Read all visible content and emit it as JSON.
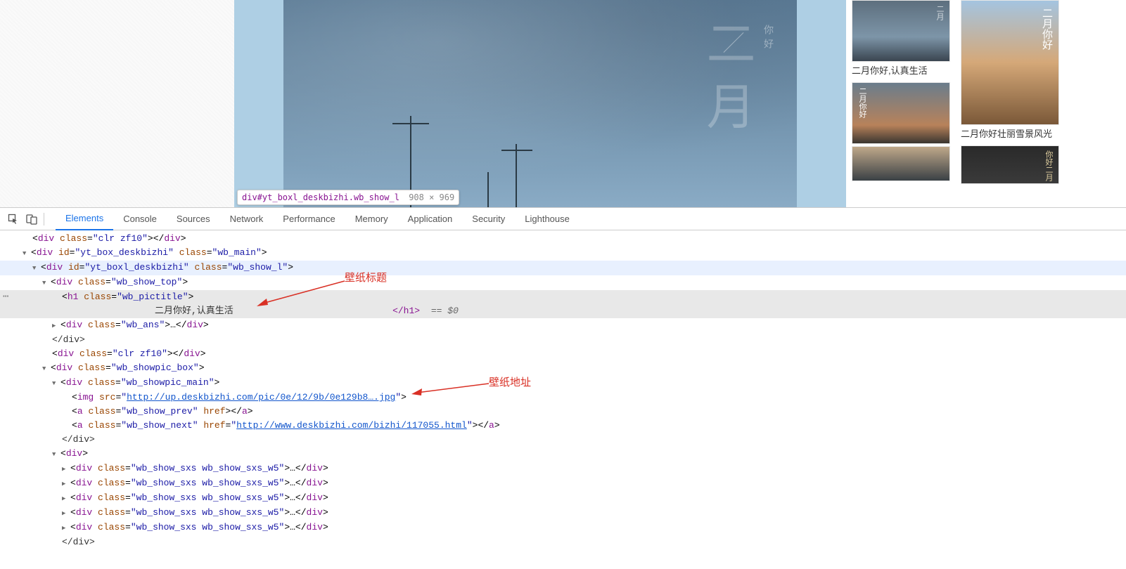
{
  "tooltip": {
    "selector": "div#yt_boxl_deskbizhi.wb_show_l",
    "dims": "908 × 969"
  },
  "main_image": {
    "small_text": "你好",
    "big_text": "二月"
  },
  "thumbs": {
    "col1": [
      {
        "cn": "二月",
        "label": "二月你好,认真生活"
      },
      {
        "cn": "二月你好",
        "label": ""
      },
      {
        "cn": "",
        "label": ""
      }
    ],
    "col2": [
      {
        "cn": "二月你好",
        "label": "二月你好壮丽雪景风光"
      },
      {
        "cn": "你好二月",
        "label": ""
      }
    ]
  },
  "devtools": {
    "tabs": [
      "Elements",
      "Console",
      "Sources",
      "Network",
      "Performance",
      "Memory",
      "Application",
      "Security",
      "Lighthouse"
    ],
    "active_tab": "Elements"
  },
  "dom": {
    "l1": {
      "tag": "div",
      "cls": "clr zf10"
    },
    "l2": {
      "tag": "div",
      "id": "yt_box_deskbizhi",
      "cls": "wb_main"
    },
    "l3": {
      "tag": "div",
      "id": "yt_boxl_deskbizhi",
      "cls": "wb_show_l"
    },
    "l4": {
      "tag": "div",
      "cls": "wb_show_top"
    },
    "l5": {
      "tag": "h1",
      "cls": "wb_pictitle"
    },
    "l5_text": "二月你好,认真生活",
    "l5_close": "</h1>",
    "l5_eq": " == $0",
    "l6": {
      "tag": "div",
      "cls": "wb_ans"
    },
    "l7": "</div>",
    "l8": {
      "tag": "div",
      "cls": "clr zf10"
    },
    "l9": {
      "tag": "div",
      "cls": "wb_showpic_box"
    },
    "l10": {
      "tag": "div",
      "cls": "wb_showpic_main"
    },
    "l11": {
      "tag": "img",
      "src": "http://up.deskbizhi.com/pic/0e/12/9b/0e129b8….jpg"
    },
    "l12": {
      "tag": "a",
      "cls": "wb_show_prev",
      "attr": "href"
    },
    "l13": {
      "tag": "a",
      "cls": "wb_show_next",
      "attr": "href",
      "href": "http://www.deskbizhi.com/bizhi/117055.html"
    },
    "l14": "</div>",
    "l15": {
      "tag": "div"
    },
    "l16": {
      "tag": "div",
      "cls": "wb_show_sxs wb_show_sxs_w5"
    },
    "l20": "</div>"
  },
  "annotations": {
    "title_label": "壁纸标题",
    "url_label": "壁纸地址"
  }
}
